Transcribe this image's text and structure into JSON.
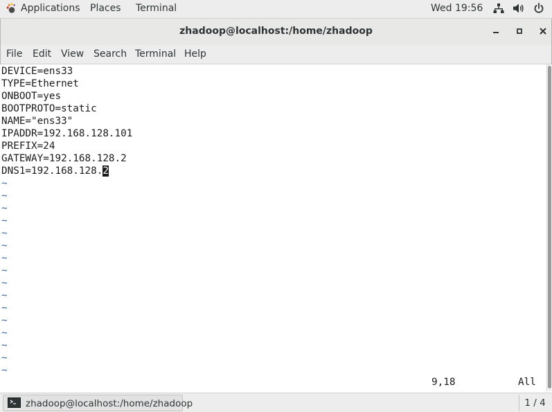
{
  "top_panel": {
    "applications": "Applications",
    "places": "Places",
    "terminal": "Terminal",
    "clock": "Wed 19:56"
  },
  "window": {
    "title": "zhadoop@localhost:/home/zhadoop"
  },
  "menu": [
    "File",
    "Edit",
    "View",
    "Search",
    "Terminal",
    "Help"
  ],
  "editor": {
    "lines": [
      "DEVICE=ens33",
      "TYPE=Ethernet",
      "ONBOOT=yes",
      "BOOTPROTO=static",
      "NAME=\"ens33\"",
      "IPADDR=192.168.128.101",
      "PREFIX=24",
      "GATEWAY=192.168.128.2"
    ],
    "last_line_before_cursor": "DNS1=192.168.128.",
    "cursor_char": "2",
    "empty_line_marker": "~",
    "empty_line_count": 16,
    "cursor_position": "9,18",
    "scroll_position": "All"
  },
  "taskbar": {
    "window_label": "zhadoop@localhost:/home/zhadoop",
    "workspace": "1 / 4"
  }
}
